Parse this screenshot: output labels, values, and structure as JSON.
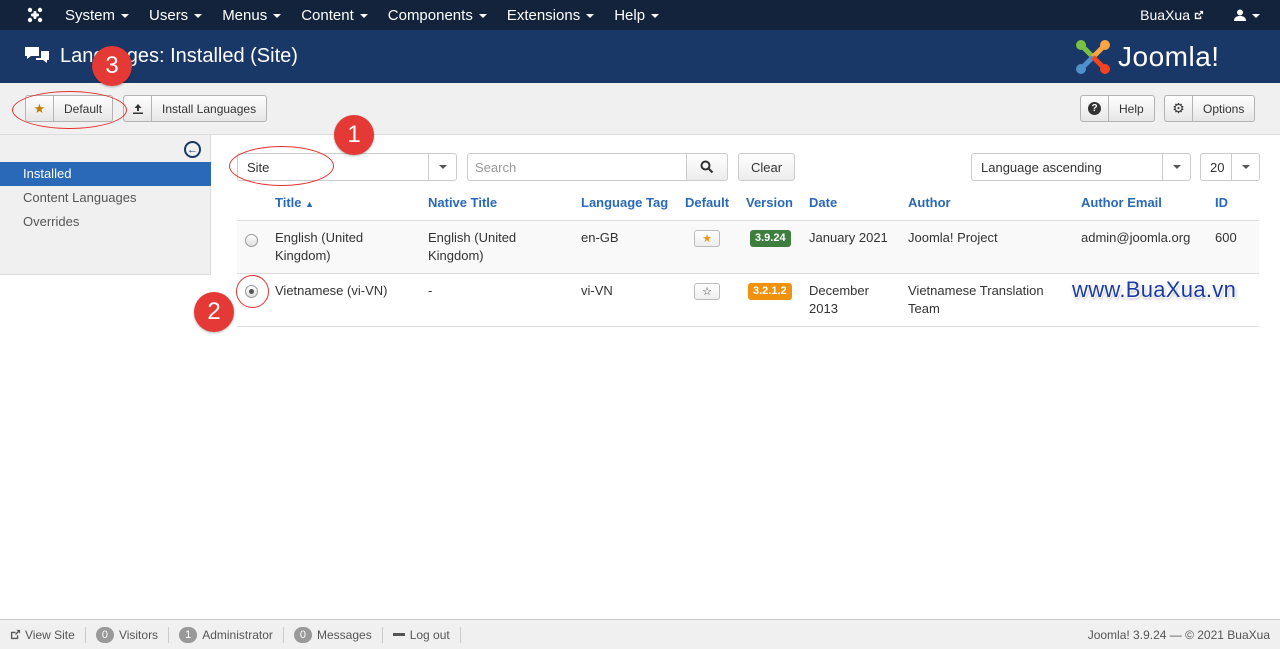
{
  "topnav": {
    "menu": [
      {
        "label": "System"
      },
      {
        "label": "Users"
      },
      {
        "label": "Menus"
      },
      {
        "label": "Content"
      },
      {
        "label": "Components"
      },
      {
        "label": "Extensions"
      },
      {
        "label": "Help"
      }
    ],
    "site_link": "BuaXua",
    "user_icon": "user-icon"
  },
  "header": {
    "title": "Languages: Installed (Site)",
    "brand": "Joomla!"
  },
  "toolbar": {
    "default_label": "Default",
    "install_label": "Install Languages",
    "help_label": "Help",
    "options_label": "Options"
  },
  "sidebar": {
    "items": [
      {
        "label": "Installed",
        "active": true
      },
      {
        "label": "Content Languages",
        "active": false
      },
      {
        "label": "Overrides",
        "active": false
      }
    ]
  },
  "filters": {
    "client": "Site",
    "search_placeholder": "Search",
    "clear_label": "Clear",
    "ordering": "Language ascending",
    "limit": "20"
  },
  "table": {
    "headers": [
      "Title",
      "Native Title",
      "Language Tag",
      "Default",
      "Version",
      "Date",
      "Author",
      "Author Email",
      "ID"
    ],
    "rows": [
      {
        "title_1": "English (United",
        "title_2": "Kingdom)",
        "native_1": "English (United",
        "native_2": "Kingdom)",
        "tag": "en-GB",
        "default": true,
        "version": "3.9.24",
        "date_1": "January 2021",
        "date_2": "",
        "author_1": "Joomla! Project",
        "author_2": "",
        "email": "admin@joomla.org",
        "id": "600",
        "selected": false
      },
      {
        "title_1": "Vietnamese (vi-VN)",
        "title_2": "",
        "native_1": "-",
        "native_2": "",
        "tag": "vi-VN",
        "default": false,
        "version": "3.2.1.2",
        "date_1": "December",
        "date_2": "2013",
        "author_1": "Vietnamese Translation",
        "author_2": "Team",
        "email": "",
        "id": "",
        "selected": true
      }
    ]
  },
  "annotations": {
    "step1": "1",
    "step2": "2",
    "step3": "3",
    "watermark": "www.BuaXua.vn"
  },
  "footer": {
    "view_site": "View Site",
    "visitors_count": "0",
    "visitors_label": "Visitors",
    "admin_count": "1",
    "admin_label": "Administrator",
    "messages_count": "0",
    "messages_label": "Messages",
    "logout": "Log out",
    "copyright": "Joomla! 3.9.24  —  © 2021 BuaXua"
  },
  "colors": {
    "topnav": "#14233c",
    "header": "#1a3867",
    "accent": "#2a69b8",
    "badge_green": "#3d7d3d",
    "badge_orange": "#f0920e",
    "annotation_red": "#e53935"
  }
}
